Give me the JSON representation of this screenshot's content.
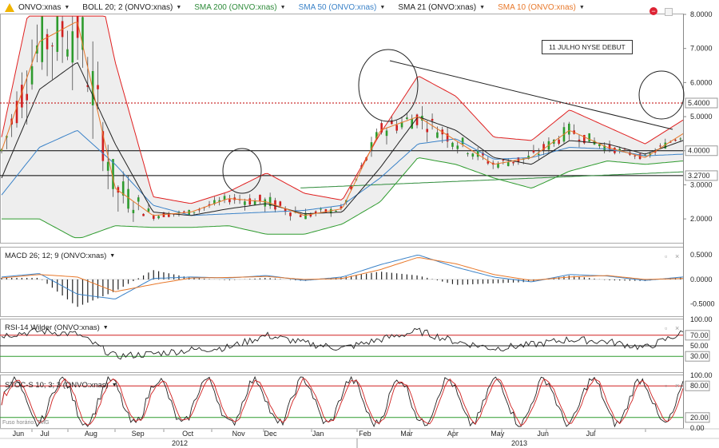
{
  "header": {
    "symbol": "ONVO:xnas",
    "indicators": [
      {
        "label": "BOLL 20; 2 (ONVO:xnas)",
        "color": "#222222"
      },
      {
        "label": "SMA 200 (ONVO:xnas)",
        "color": "#2e8b3a"
      },
      {
        "label": "SMA 50 (ONVO:xnas)",
        "color": "#3a82c8"
      },
      {
        "label": "SMA 21 (ONVO:xnas)",
        "color": "#222222"
      },
      {
        "label": "SMA 10 (ONVO:xnas)",
        "color": "#e8782a"
      }
    ]
  },
  "annotation": "11 JULHO NYSE DEBUT",
  "timezone": "Fuso horário: TMG",
  "panels": {
    "macd": "MACD 26; 12; 9 (ONVO:xnas)",
    "rsi": "RSI-14 Wilder (ONVO:xnas)",
    "stoc": "STOC-S 10; 3; 3 (ONVO:xnas)"
  },
  "chart_data": {
    "type": "line",
    "price_axis": {
      "ticks": [
        "2.0000",
        "3.0000",
        "4.0000",
        "5.0000",
        "6.0000",
        "7.0000",
        "8.0000"
      ],
      "ylim": [
        1.3,
        8.0
      ]
    },
    "price_labels": [
      {
        "value": 5.4,
        "label": "5.4000",
        "style": "dashed",
        "color": "#c00000"
      },
      {
        "value": 4.0,
        "label": "4.0000",
        "style": "solid",
        "color": "#000000"
      },
      {
        "value": 3.27,
        "label": "3.2700",
        "style": "solid",
        "color": "#000000"
      }
    ],
    "macd_axis": {
      "ticks": [
        "0.5000",
        "0.0000",
        "-0.5000"
      ],
      "ylim": [
        -0.75,
        0.65
      ]
    },
    "rsi_axis": {
      "ticks": [
        "100.00",
        "70.00",
        "50.00",
        "30.00"
      ],
      "ylim": [
        0,
        100
      ],
      "levels": [
        70,
        50,
        30
      ]
    },
    "stoc_axis": {
      "ticks": [
        "100.00",
        "80.00",
        "20.00",
        "0.00"
      ],
      "ylim": [
        0,
        100
      ],
      "levels": [
        80,
        20
      ]
    },
    "months": [
      "Jun",
      "Jul",
      "Aug",
      "Sep",
      "Oct",
      "Nov",
      "Dec",
      "Jan",
      "Feb",
      "Mar",
      "Apr",
      "May",
      "Jun",
      "Jul"
    ],
    "years": [
      "2012",
      "2013"
    ],
    "colors": {
      "bollinger": "#e02020",
      "bollinger_lower": "#2e9b2e",
      "sma200": "#2e8b3a",
      "sma50": "#3a82c8",
      "sma21": "#222222",
      "sma10": "#e8782a",
      "up": "#2e9b2e",
      "down": "#d02020"
    },
    "series": [
      {
        "name": "SMA 200",
        "values": [
          2.55,
          2.6,
          2.66,
          2.72,
          2.78,
          2.84,
          2.9,
          2.96,
          3.02,
          3.08,
          3.14,
          3.2,
          3.26,
          3.32,
          3.38
        ]
      },
      {
        "name": "SMA 50",
        "values": [
          2.7,
          4.1,
          4.6,
          3.6,
          2.4,
          2.1,
          2.15,
          2.2,
          2.25,
          2.4,
          3.2,
          4.2,
          4.35,
          3.75,
          3.8,
          4.1,
          4.05,
          3.85,
          3.9
        ]
      },
      {
        "name": "SMA 21",
        "values": [
          3.2,
          5.8,
          6.6,
          4.2,
          2.2,
          2.1,
          2.3,
          2.45,
          2.15,
          2.2,
          3.5,
          5.0,
          4.6,
          3.8,
          3.6,
          4.3,
          4.2,
          3.9,
          4.3
        ]
      },
      {
        "name": "SMA 10",
        "values": [
          4.0,
          7.2,
          7.8,
          2.9,
          2.1,
          2.2,
          2.6,
          2.5,
          2.1,
          2.3,
          4.6,
          5.0,
          4.3,
          3.6,
          3.8,
          4.6,
          4.1,
          3.8,
          4.5
        ]
      }
    ]
  }
}
